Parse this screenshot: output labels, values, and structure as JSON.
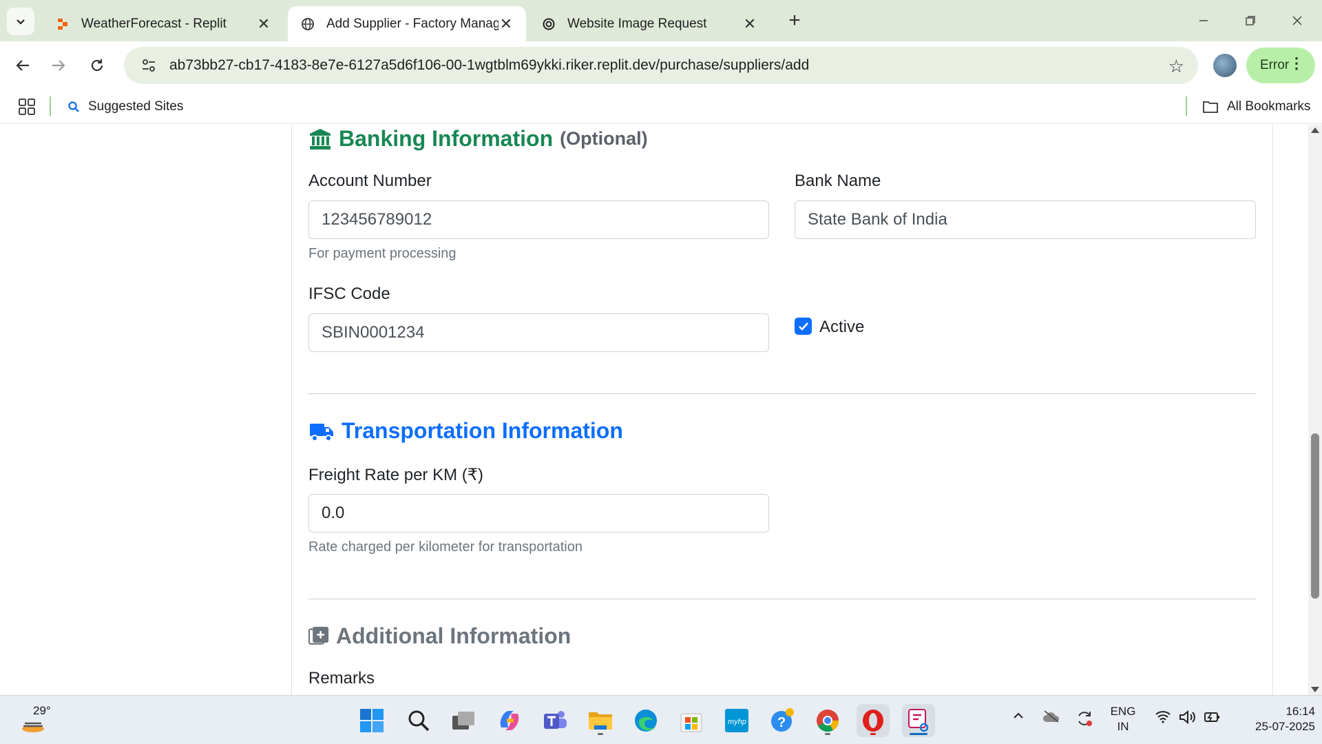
{
  "browser": {
    "tabs": [
      {
        "title": "WeatherForecast - Replit",
        "icon": "replit-icon",
        "active": false
      },
      {
        "title": "Add Supplier - Factory Manager",
        "icon": "globe-icon",
        "active": true
      },
      {
        "title": "Website Image Request",
        "icon": "openai-icon",
        "active": false
      }
    ],
    "url": "ab73bb27-cb17-4183-8e7e-6127a5d6f106-00-1wgtblm69ykki.riker.replit.dev/purchase/suppliers/add",
    "profile_status": "Error",
    "bookmarks": {
      "suggested": "Suggested Sites",
      "all": "All Bookmarks"
    }
  },
  "page": {
    "banking": {
      "title": "Banking Information",
      "optional": "(Optional)",
      "account_number_label": "Account Number",
      "account_number_value": "123456789012",
      "account_number_help": "For payment processing",
      "bank_name_label": "Bank Name",
      "bank_name_value": "State Bank of India",
      "ifsc_label": "IFSC Code",
      "ifsc_value": "SBIN0001234",
      "active_label": "Active",
      "active_checked": true
    },
    "transport": {
      "title": "Transportation Information",
      "freight_label": "Freight Rate per KM (₹)",
      "freight_value": "0.0",
      "freight_help": "Rate charged per kilometer for transportation"
    },
    "additional": {
      "title": "Additional Information",
      "remarks_label": "Remarks"
    },
    "colors": {
      "banking_green": "#198754",
      "transport_blue": "#0d6efd",
      "additional_gray": "#6c757d"
    }
  },
  "taskbar": {
    "weather_temp": "29°",
    "lang_line1": "ENG",
    "lang_line2": "IN",
    "time": "16:14",
    "date": "25-07-2025"
  }
}
